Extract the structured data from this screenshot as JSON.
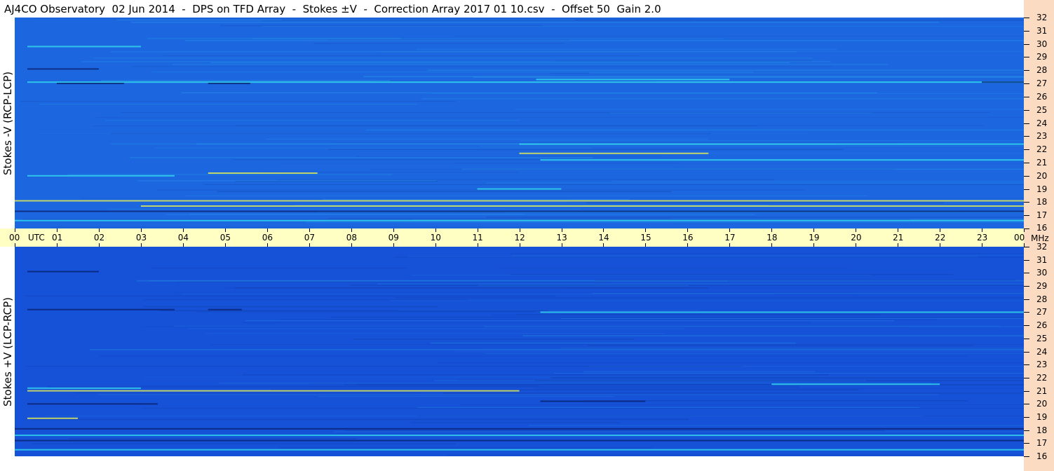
{
  "title": "AJ4CO Observatory  02 Jun 2014  -  DPS on TFD Array  -  Stokes ±V  -  Correction Array 2017 01 10.csv  -  Offset 50  Gain 2.0",
  "chart_data": [
    {
      "type": "heatmap",
      "name": "Stokes -V (RCP-LCP)",
      "ylabel": "Stokes -V (RCP-LCP)",
      "xlabel": "UTC",
      "x_ticks": [
        "00",
        "01",
        "02",
        "03",
        "04",
        "05",
        "06",
        "07",
        "08",
        "09",
        "10",
        "11",
        "12",
        "13",
        "14",
        "15",
        "16",
        "17",
        "18",
        "19",
        "20",
        "21",
        "22",
        "23",
        "00"
      ],
      "y_unit": "MHz",
      "ylim": [
        16,
        32
      ],
      "y_ticks": [
        16,
        17,
        18,
        19,
        20,
        21,
        22,
        23,
        24,
        25,
        26,
        27,
        28,
        29,
        30,
        31,
        32
      ],
      "colors": {
        "background": "#1c66e0",
        "bright": "#33ddee",
        "strong": "#e8f050",
        "dark": "#0a1f6a"
      },
      "features": [
        {
          "freq": 27.1,
          "start": 0.3,
          "end": 24.0,
          "kind": "bright"
        },
        {
          "freq": 27.3,
          "start": 12.4,
          "end": 17.0,
          "kind": "bright"
        },
        {
          "freq": 28.1,
          "start": 0.3,
          "end": 2.0,
          "kind": "dark"
        },
        {
          "freq": 27.0,
          "start": 1.0,
          "end": 2.6,
          "kind": "dark"
        },
        {
          "freq": 27.0,
          "start": 4.6,
          "end": 5.6,
          "kind": "dark"
        },
        {
          "freq": 27.1,
          "start": 23.0,
          "end": 24.0,
          "kind": "dark"
        },
        {
          "freq": 21.7,
          "start": 12.0,
          "end": 16.5,
          "kind": "strong"
        },
        {
          "freq": 21.2,
          "start": 12.5,
          "end": 24.0,
          "kind": "bright"
        },
        {
          "freq": 20.0,
          "start": 0.3,
          "end": 3.8,
          "kind": "bright"
        },
        {
          "freq": 20.2,
          "start": 4.6,
          "end": 7.2,
          "kind": "strong"
        },
        {
          "freq": 19.0,
          "start": 11.0,
          "end": 13.0,
          "kind": "bright"
        },
        {
          "freq": 18.1,
          "start": 0.0,
          "end": 24.0,
          "kind": "strong"
        },
        {
          "freq": 17.7,
          "start": 3.0,
          "end": 24.0,
          "kind": "strong"
        },
        {
          "freq": 17.3,
          "start": 0.0,
          "end": 24.0,
          "kind": "dark"
        },
        {
          "freq": 16.6,
          "start": 0.0,
          "end": 24.0,
          "kind": "bright"
        },
        {
          "freq": 29.8,
          "start": 0.3,
          "end": 3.0,
          "kind": "bright"
        },
        {
          "freq": 22.4,
          "start": 12.0,
          "end": 24.0,
          "kind": "bright"
        }
      ]
    },
    {
      "type": "heatmap",
      "name": "Stokes +V (LCP-RCP)",
      "ylabel": "Stokes +V (LCP-RCP)",
      "xlabel": "UTC",
      "x_ticks": [
        "00",
        "01",
        "02",
        "03",
        "04",
        "05",
        "06",
        "07",
        "08",
        "09",
        "10",
        "11",
        "12",
        "13",
        "14",
        "15",
        "16",
        "17",
        "18",
        "19",
        "20",
        "21",
        "22",
        "23",
        "00"
      ],
      "y_unit": "MHz",
      "ylim": [
        16,
        32
      ],
      "y_ticks": [
        16,
        17,
        18,
        19,
        20,
        21,
        22,
        23,
        24,
        25,
        26,
        27,
        28,
        29,
        30,
        31,
        32
      ],
      "colors": {
        "background": "#1652d8",
        "bright": "#33ddee",
        "strong": "#e8f050",
        "dark": "#0a1f6a"
      },
      "features": [
        {
          "freq": 27.2,
          "start": 0.3,
          "end": 3.8,
          "kind": "dark"
        },
        {
          "freq": 27.2,
          "start": 4.6,
          "end": 5.4,
          "kind": "dark"
        },
        {
          "freq": 27.0,
          "start": 12.5,
          "end": 24.0,
          "kind": "bright"
        },
        {
          "freq": 30.1,
          "start": 0.3,
          "end": 2.0,
          "kind": "dark"
        },
        {
          "freq": 21.2,
          "start": 0.3,
          "end": 3.0,
          "kind": "bright"
        },
        {
          "freq": 21.5,
          "start": 18.0,
          "end": 22.0,
          "kind": "bright"
        },
        {
          "freq": 20.0,
          "start": 0.3,
          "end": 3.4,
          "kind": "dark"
        },
        {
          "freq": 20.2,
          "start": 12.5,
          "end": 15.0,
          "kind": "dark"
        },
        {
          "freq": 18.1,
          "start": 0.0,
          "end": 24.0,
          "kind": "dark"
        },
        {
          "freq": 17.6,
          "start": 0.0,
          "end": 24.0,
          "kind": "bright"
        },
        {
          "freq": 17.2,
          "start": 0.0,
          "end": 24.0,
          "kind": "dark"
        },
        {
          "freq": 16.5,
          "start": 0.0,
          "end": 24.0,
          "kind": "bright"
        },
        {
          "freq": 18.9,
          "start": 0.3,
          "end": 1.5,
          "kind": "strong"
        },
        {
          "freq": 21.0,
          "start": 0.3,
          "end": 12.0,
          "kind": "strong"
        }
      ]
    }
  ],
  "axis": {
    "time_label": "UTC",
    "freq_unit": "MHz"
  }
}
